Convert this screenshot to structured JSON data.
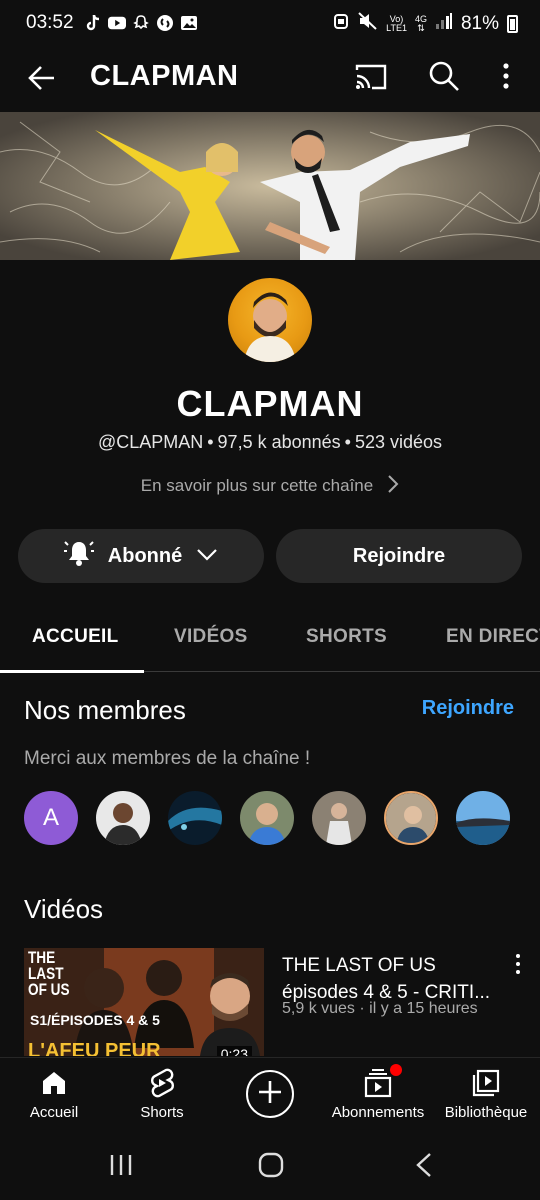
{
  "status_bar": {
    "time": "03:52",
    "volte": "Vo)",
    "lte": "LTE1",
    "network": "4G",
    "battery": "81%"
  },
  "app_bar": {
    "title": "CLAPMAN",
    "icons": [
      "back-arrow-icon",
      "cast-icon",
      "search-icon",
      "more-vert-icon"
    ]
  },
  "channel": {
    "name": "CLAPMAN",
    "handle": "@CLAPMAN",
    "subscribers": "97,5 k abonnés",
    "videos_count": "523 vidéos",
    "about_link": "En savoir plus sur cette chaîne"
  },
  "actions": {
    "subscribed_label": "Abonné",
    "join_label": "Rejoindre"
  },
  "tabs": [
    {
      "label": "ACCUEIL",
      "active": true
    },
    {
      "label": "VIDÉOS",
      "active": false
    },
    {
      "label": "SHORTS",
      "active": false
    },
    {
      "label": "EN DIRECT",
      "active": false
    }
  ],
  "members": {
    "title": "Nos membres",
    "join_link": "Rejoindre",
    "subtitle": "Merci aux membres de la chaîne !",
    "first_initial": "A"
  },
  "videos_section": {
    "title": "Vidéos",
    "items": [
      {
        "title": "THE LAST OF US épisodes 4 & 5 - CRITI...",
        "title_line1": "THE LAST OF US",
        "title_line2": "épisodes 4 & 5 - CRITI...",
        "views": "5,9 k vues",
        "age": "il y a 15 heures",
        "thumb_line1": "THE",
        "thumb_line2": "LAST",
        "thumb_line3": "OF US",
        "thumb_caption": "S1/ÉPISODES 4 & 5",
        "thumb_caption2": "L'AFEU PEUR",
        "thumb_duration": "0:23"
      }
    ]
  },
  "bottom_nav": [
    {
      "label": "Accueil",
      "icon": "home-icon"
    },
    {
      "label": "Shorts",
      "icon": "shorts-icon"
    },
    {
      "label": "",
      "icon": "create-plus-icon"
    },
    {
      "label": "Abonnements",
      "icon": "subscriptions-icon"
    },
    {
      "label": "Bibliothèque",
      "icon": "library-icon"
    }
  ],
  "colors": {
    "background": "#0f0f0f",
    "accent_link": "#3ea6ff",
    "button_bg": "#272727",
    "notification_dot": "#ff0000"
  }
}
